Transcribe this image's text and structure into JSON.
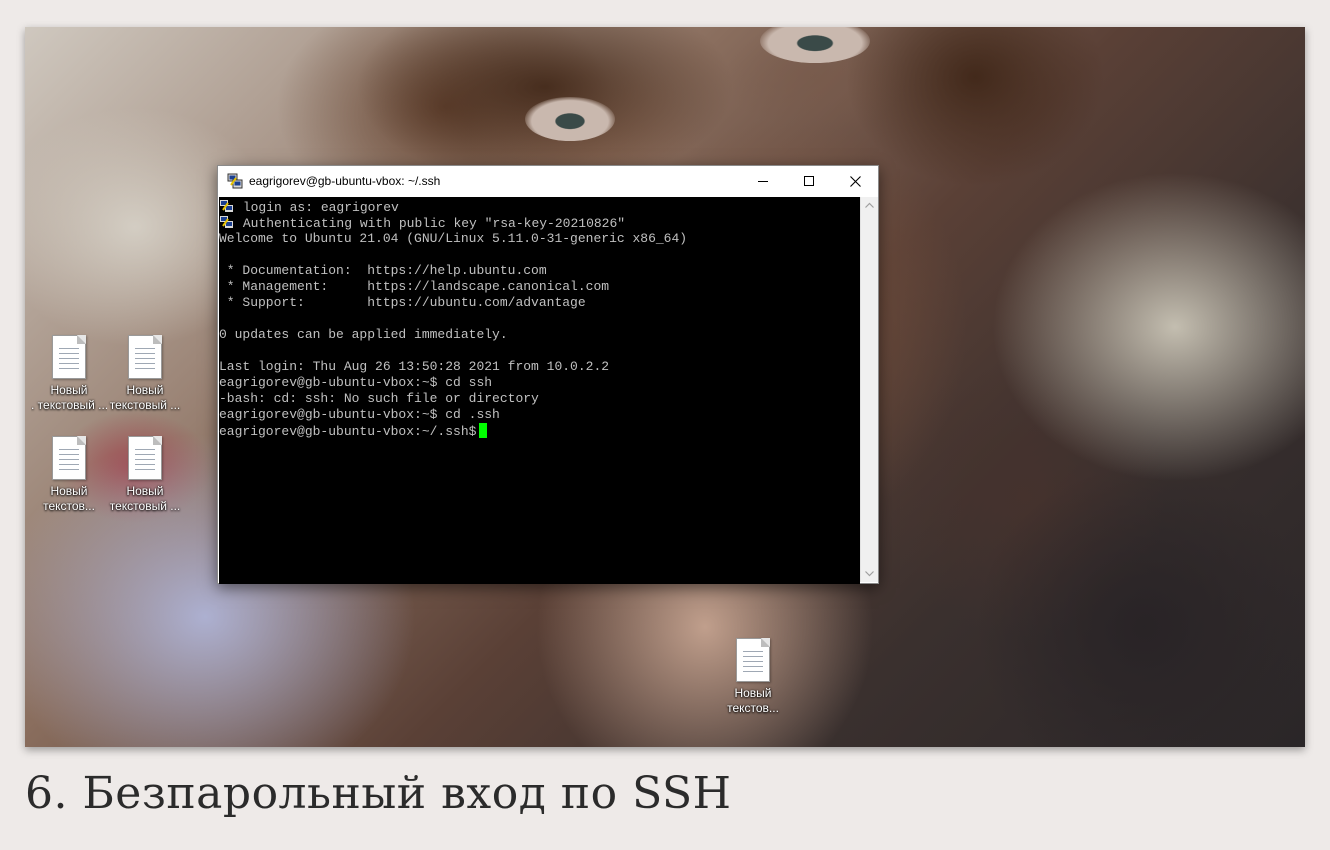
{
  "window": {
    "title": "eagrigorev@gb-ubuntu-vbox: ~/.ssh",
    "app_icon": "putty-icon",
    "controls": [
      "minimize",
      "maximize",
      "close"
    ]
  },
  "terminal": {
    "lines": [
      "login as: eagrigorev",
      "Authenticating with public key \"rsa-key-20210826\"",
      "Welcome to Ubuntu 21.04 (GNU/Linux 5.11.0-31-generic x86_64)",
      "",
      " * Documentation:  https://help.ubuntu.com",
      " * Management:     https://landscape.canonical.com",
      " * Support:        https://ubuntu.com/advantage",
      "",
      "0 updates can be applied immediately.",
      "",
      "Last login: Thu Aug 26 13:50:28 2021 from 10.0.2.2",
      "eagrigorev@gb-ubuntu-vbox:~$ cd ssh",
      "-bash: cd: ssh: No such file or directory",
      "eagrigorev@gb-ubuntu-vbox:~$ cd .ssh",
      "eagrigorev@gb-ubuntu-vbox:~/.ssh$"
    ],
    "text_color": "#c0c0c0",
    "background": "#000000",
    "cursor_color": "#00ff00"
  },
  "desktop": {
    "icons": [
      {
        "line1": "Новый",
        "line2": ". текстовый ...",
        "icon": "text-document-icon"
      },
      {
        "line1": "Новый",
        "line2": "текстовый ...",
        "icon": "text-document-icon"
      },
      {
        "line1": "Новый",
        "line2": "текстов...",
        "icon": "text-document-icon"
      },
      {
        "line1": "Новый",
        "line2": "текстовый ...",
        "icon": "text-document-icon"
      },
      {
        "line1": "Новый",
        "line2": "текстов...",
        "icon": "text-document-icon"
      }
    ]
  },
  "caption": "6. Безпарольный вход по SSH"
}
